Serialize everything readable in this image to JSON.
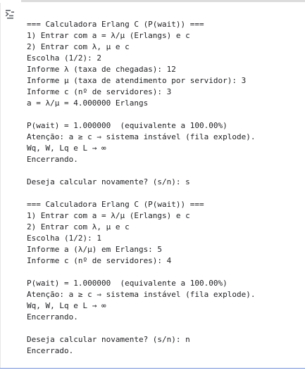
{
  "toolbar": {
    "output_toggle_icon": "clear-output-icon"
  },
  "output": {
    "lines": [
      "=== Calculadora Erlang C (P(wait)) ===",
      "1) Entrar com a = λ/μ (Erlangs) e c",
      "2) Entrar com λ, μ e c",
      "Escolha (1/2): 2",
      "Informe λ (taxa de chegadas): 12",
      "Informe μ (taxa de atendimento por servidor): 3",
      "Informe c (nº de servidores): 3",
      "a = λ/μ = 4.000000 Erlangs",
      "",
      "P(wait) = 1.000000  (equivalente a 100.00%)",
      "Atenção: a ≥ c ⇒ sistema instável (fila explode).",
      "Wq, W, Lq e L → ∞",
      "Encerrando.",
      "",
      "Deseja calcular novamente? (s/n): s",
      "",
      "=== Calculadora Erlang C (P(wait)) ===",
      "1) Entrar com a = λ/μ (Erlangs) e c",
      "2) Entrar com λ, μ e c",
      "Escolha (1/2): 1",
      "Informe a (λ/μ) em Erlangs: 5",
      "Informe c (nº de servidores): 4",
      "",
      "P(wait) = 1.000000  (equivalente a 100.00%)",
      "Atenção: a ≥ c ⇒ sistema instável (fila explode).",
      "Wq, W, Lq e L → ∞",
      "Encerrando.",
      "",
      "Deseja calcular novamente? (s/n): n",
      "Encerrado."
    ]
  }
}
